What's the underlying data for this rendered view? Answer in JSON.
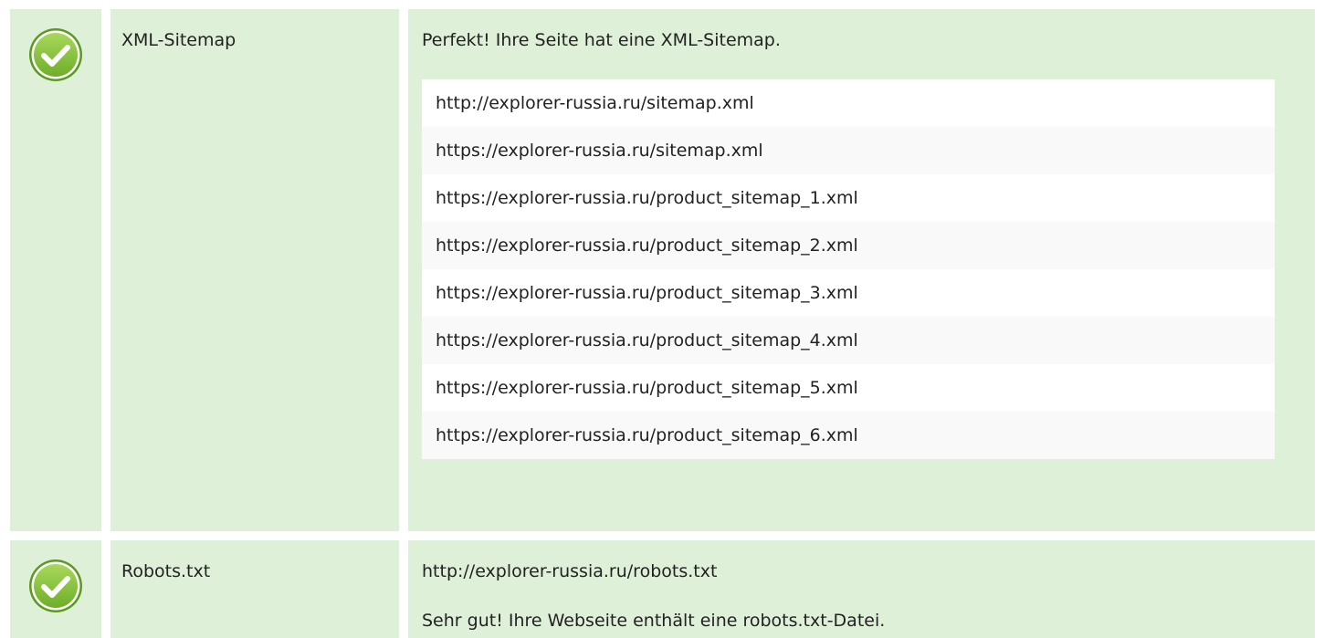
{
  "sitemap": {
    "name": "XML-Sitemap",
    "message": "Perfekt! Ihre Seite hat eine XML-Sitemap.",
    "urls": [
      "http://explorer-russia.ru/sitemap.xml",
      "https://explorer-russia.ru/sitemap.xml",
      "https://explorer-russia.ru/product_sitemap_1.xml",
      "https://explorer-russia.ru/product_sitemap_2.xml",
      "https://explorer-russia.ru/product_sitemap_3.xml",
      "https://explorer-russia.ru/product_sitemap_4.xml",
      "https://explorer-russia.ru/product_sitemap_5.xml",
      "https://explorer-russia.ru/product_sitemap_6.xml"
    ],
    "status_icon": "check-circle-icon"
  },
  "robots": {
    "name": "Robots.txt",
    "url": "http://explorer-russia.ru/robots.txt",
    "message": "Sehr gut! Ihre Webseite enthält eine robots.txt-Datei.",
    "status_icon": "check-circle-icon"
  },
  "colors": {
    "row_background": "#dff0d8",
    "check_green": "#8cc63f",
    "check_dark": "#5a9a1f"
  }
}
